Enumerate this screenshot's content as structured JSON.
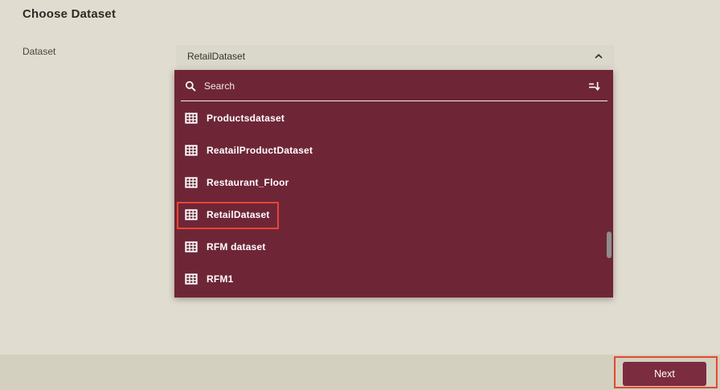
{
  "page": {
    "title": "Choose Dataset"
  },
  "form": {
    "label": "Dataset",
    "selected_value": "RetailDataset"
  },
  "dropdown": {
    "search_placeholder": "Search",
    "options": [
      "Productsdataset",
      "ReatailProductDataset",
      "Restaurant_Floor",
      "RetailDataset",
      "RFM dataset",
      "RFM1"
    ],
    "highlighted_option": "RetailDataset"
  },
  "footer": {
    "next_label": "Next"
  },
  "icons": {
    "search": "magnifying-glass",
    "sort": "sort-descending",
    "option": "table-grid",
    "field_state": "chevron-up"
  },
  "colors": {
    "page_bg": "#e0ddd0",
    "footer_bg": "#d3d0bf",
    "field_bg": "#dad7cb",
    "panel_bg": "#6e2637",
    "button_bg": "#7b2c3e",
    "highlight_border": "#e84632",
    "text_dark": "#2e2a24",
    "text_light": "#ffffff"
  }
}
